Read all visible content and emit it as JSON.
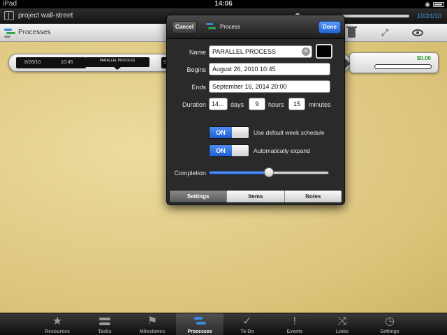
{
  "status_bar": {
    "device": "iPad",
    "time": "14:06"
  },
  "title_bar": {
    "project_title": "project wall-street",
    "end_date": "10/24/10",
    "timeline_progress": 0.05
  },
  "toolbar": {
    "section_title": "Processes"
  },
  "process_row": {
    "start_date": "8/26/10",
    "start_time": "10:45",
    "name_tag": "PARALLEL PROCESS",
    "end_partial": "9",
    "cost": "$0.00"
  },
  "popover": {
    "cancel_label": "Cancel",
    "done_label": "Done",
    "title": "Process",
    "name_label": "Name",
    "name_value": "PARALLEL PROCESS",
    "begins_label": "Begins",
    "begins_value": "August 26, 2010 10:45",
    "ends_label": "Ends",
    "ends_value": "September 16, 2014 20:00",
    "duration_label": "Duration",
    "duration_days": "14…",
    "days_unit": "days",
    "duration_hours": "9",
    "hours_unit": "hours",
    "duration_minutes": "15",
    "minutes_unit": "minutes",
    "toggle_on_text": "ON",
    "week_schedule_label": "Use default week schedule",
    "auto_expand_label": "Automatically expand",
    "completion_label": "Completion",
    "completion_value": 0.5,
    "tabs": [
      {
        "label": "Settings",
        "active": true
      },
      {
        "label": "Items",
        "active": false
      },
      {
        "label": "Notes",
        "active": false
      }
    ],
    "swatch_color": "#000000"
  },
  "bottom_tabs": [
    {
      "label": "Resources",
      "icon": "star-icon",
      "active": false
    },
    {
      "label": "Tasks",
      "icon": "tasks-icon",
      "active": false
    },
    {
      "label": "Milestones",
      "icon": "flag-icon",
      "active": false
    },
    {
      "label": "Processes",
      "icon": "processes-icon",
      "active": true
    },
    {
      "label": "To Do",
      "icon": "checkmark-icon",
      "active": false
    },
    {
      "label": "Events",
      "icon": "exclamation-icon",
      "active": false
    },
    {
      "label": "Links",
      "icon": "shuffle-icon",
      "active": false
    },
    {
      "label": "Settings",
      "icon": "clock-icon",
      "active": false
    }
  ],
  "colors": {
    "accent_blue": "#2563d8",
    "cost_green": "#2a9a2a",
    "canvas_yellow": "#dcc47a"
  }
}
